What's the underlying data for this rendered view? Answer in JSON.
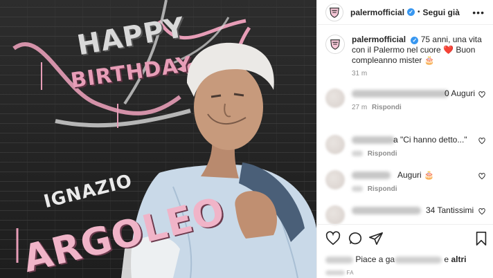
{
  "post": {
    "graffiti_line1": "HAPPY",
    "graffiti_line2": "BIRTHDAY",
    "first_name": "IGNAZIO",
    "last_name": "ARGOLEO"
  },
  "header": {
    "username": "palermofficial",
    "follow_label": "Segui già",
    "separator": "•",
    "more": "•••"
  },
  "caption": {
    "username": "palermofficial",
    "text": "75 anni, una vita con il Palermo nel cuore",
    "text_after_heart": "Buon compleanno mister",
    "emoji_heart": "❤️",
    "emoji_cake": "🎂",
    "time": "31 m"
  },
  "comments": [
    {
      "text": "0 Auguri",
      "time": "27 m",
      "reply": "Rispondi"
    },
    {
      "text": "a \"Ci hanno detto...\"",
      "time": "",
      "reply": "Rispondi"
    },
    {
      "text": "Auguri",
      "emoji": "🎂",
      "time": "",
      "reply": "Rispondi"
    },
    {
      "text": "34 Tantissimi",
      "time": "",
      "reply": ""
    }
  ],
  "likes": {
    "prefix": "Piace a ga",
    "suffix": "e",
    "others": "altri"
  },
  "timestamp_suffix": "FA",
  "colors": {
    "verified": "#3897f0",
    "brand_pink": "#f0b4c8"
  }
}
